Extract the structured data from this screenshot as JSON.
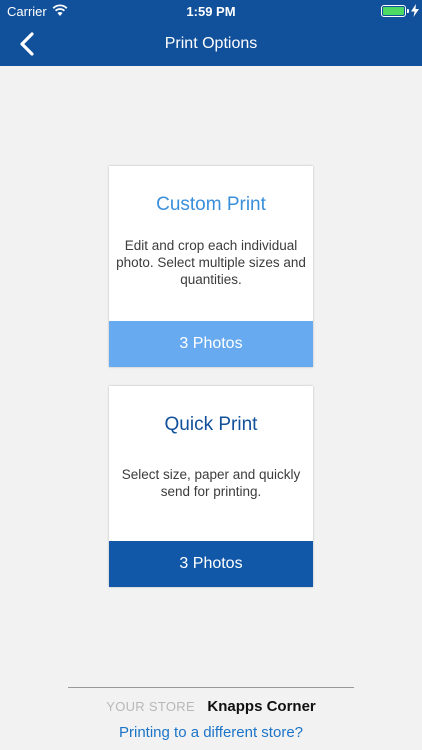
{
  "status_bar": {
    "carrier": "Carrier",
    "time": "1:59 PM"
  },
  "header": {
    "title": "Print Options"
  },
  "options": [
    {
      "title": "Custom Print",
      "description": "Edit and crop each individual photo. Select multiple sizes and quantities.",
      "button_label": "3 Photos"
    },
    {
      "title": "Quick Print",
      "description": "Select size, paper and quickly send for printing.",
      "button_label": "3 Photos"
    }
  ],
  "footer": {
    "store_label": "YOUR STORE",
    "store_name": "Knapps Corner",
    "change_store_link": "Printing to a different store?"
  },
  "colors": {
    "header_bg": "#11509a",
    "custom_title": "#3a8fdb",
    "custom_button": "#68aaf0",
    "quick_title": "#11509a",
    "quick_button": "#1159a8",
    "link": "#1c74c8"
  }
}
